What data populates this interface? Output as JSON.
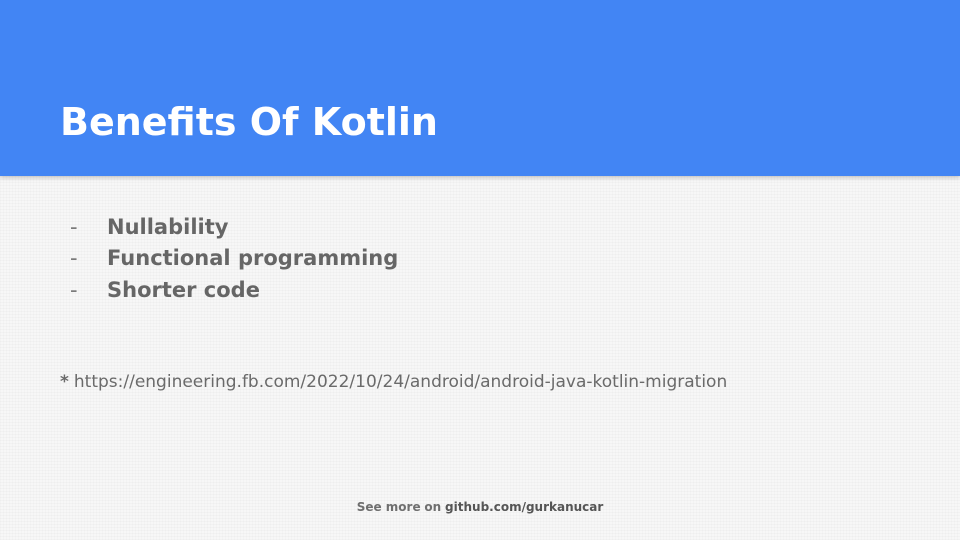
{
  "slide": {
    "title": "Benefits Of Kotlin",
    "bullets": [
      {
        "marker": "-",
        "text": "Nullability"
      },
      {
        "marker": "-",
        "text": "Functional programming"
      },
      {
        "marker": "-",
        "text": "Shorter code"
      }
    ],
    "footnote": {
      "marker": "*",
      "url": "https://engineering.fb.com/2022/10/24/android/android-java-kotlin-migration"
    },
    "footer": {
      "prefix": "See more",
      "connector": "on",
      "link": "github.com/gurkanucar"
    }
  },
  "colors": {
    "header_background": "#4285f4",
    "title_text": "#ffffff",
    "body_text": "#666666",
    "page_background": "#f7f7f7"
  }
}
